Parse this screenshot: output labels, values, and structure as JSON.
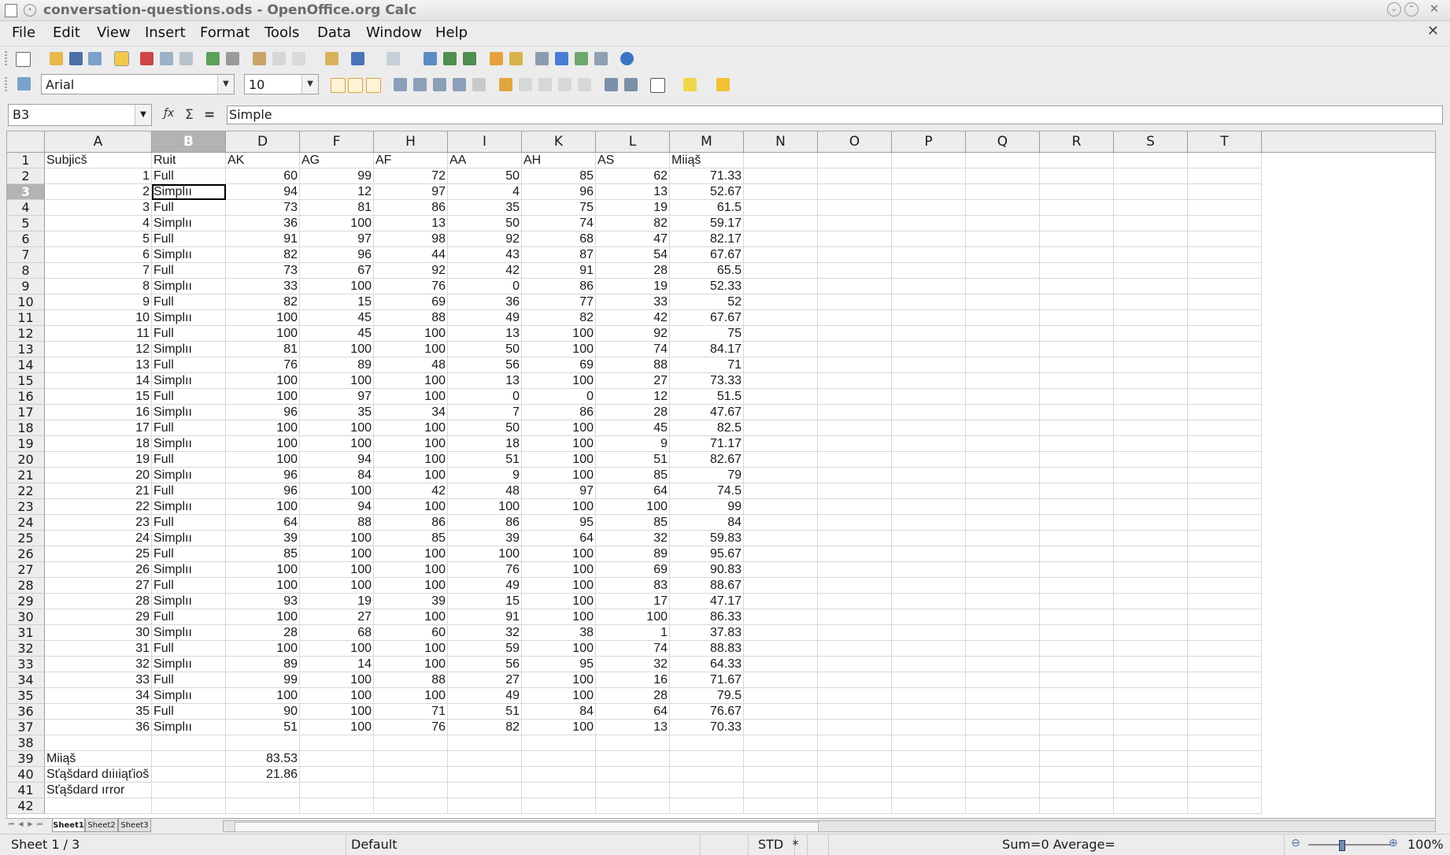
{
  "window": {
    "title": "conversation-questions.ods - OpenOffice.org Calc"
  },
  "menu": [
    "File",
    "Edit",
    "View",
    "Insert",
    "Format",
    "Tools",
    "Data",
    "Window",
    "Help"
  ],
  "toolbar": {
    "font_name": "Arial",
    "font_size": "10"
  },
  "formula_bar": {
    "cell_ref": "B3",
    "content": "Simple"
  },
  "columns": [
    "A",
    "B",
    "D",
    "F",
    "H",
    "I",
    "K",
    "L",
    "M",
    "N",
    "O",
    "P",
    "Q",
    "R",
    "S",
    "T"
  ],
  "selected_column": "B",
  "selected_row": 3,
  "header_row": [
    "Subjicš",
    "Ruit",
    "AK",
    "AG",
    "AF",
    "AA",
    "AH",
    "AS",
    "Miiąš"
  ],
  "data_rows": [
    [
      1,
      "Full",
      60,
      99,
      72,
      50,
      85,
      62,
      "71.33"
    ],
    [
      2,
      "Simplıı",
      94,
      12,
      97,
      4,
      96,
      13,
      "52.67"
    ],
    [
      3,
      "Full",
      73,
      81,
      86,
      35,
      75,
      19,
      "61.5"
    ],
    [
      4,
      "Simplıı",
      36,
      100,
      13,
      50,
      74,
      82,
      "59.17"
    ],
    [
      5,
      "Full",
      91,
      97,
      98,
      92,
      68,
      47,
      "82.17"
    ],
    [
      6,
      "Simplıı",
      82,
      96,
      44,
      43,
      87,
      54,
      "67.67"
    ],
    [
      7,
      "Full",
      73,
      67,
      92,
      42,
      91,
      28,
      "65.5"
    ],
    [
      8,
      "Simplıı",
      33,
      100,
      76,
      0,
      86,
      19,
      "52.33"
    ],
    [
      9,
      "Full",
      82,
      15,
      69,
      36,
      77,
      33,
      "52"
    ],
    [
      10,
      "Simplıı",
      100,
      45,
      88,
      49,
      82,
      42,
      "67.67"
    ],
    [
      11,
      "Full",
      100,
      45,
      100,
      13,
      100,
      92,
      "75"
    ],
    [
      12,
      "Simplıı",
      81,
      100,
      100,
      50,
      100,
      74,
      "84.17"
    ],
    [
      13,
      "Full",
      76,
      89,
      48,
      56,
      69,
      88,
      "71"
    ],
    [
      14,
      "Simplıı",
      100,
      100,
      100,
      13,
      100,
      27,
      "73.33"
    ],
    [
      15,
      "Full",
      100,
      97,
      100,
      0,
      0,
      12,
      "51.5"
    ],
    [
      16,
      "Simplıı",
      96,
      35,
      34,
      7,
      86,
      28,
      "47.67"
    ],
    [
      17,
      "Full",
      100,
      100,
      100,
      50,
      100,
      45,
      "82.5"
    ],
    [
      18,
      "Simplıı",
      100,
      100,
      100,
      18,
      100,
      9,
      "71.17"
    ],
    [
      19,
      "Full",
      100,
      94,
      100,
      51,
      100,
      51,
      "82.67"
    ],
    [
      20,
      "Simplıı",
      96,
      84,
      100,
      9,
      100,
      85,
      "79"
    ],
    [
      21,
      "Full",
      96,
      100,
      42,
      48,
      97,
      64,
      "74.5"
    ],
    [
      22,
      "Simplıı",
      100,
      94,
      100,
      100,
      100,
      100,
      "99"
    ],
    [
      23,
      "Full",
      64,
      88,
      86,
      86,
      95,
      85,
      "84"
    ],
    [
      24,
      "Simplıı",
      39,
      100,
      85,
      39,
      64,
      32,
      "59.83"
    ],
    [
      25,
      "Full",
      85,
      100,
      100,
      100,
      100,
      89,
      "95.67"
    ],
    [
      26,
      "Simplıı",
      100,
      100,
      100,
      76,
      100,
      69,
      "90.83"
    ],
    [
      27,
      "Full",
      100,
      100,
      100,
      49,
      100,
      83,
      "88.67"
    ],
    [
      28,
      "Simplıı",
      93,
      19,
      39,
      15,
      100,
      17,
      "47.17"
    ],
    [
      29,
      "Full",
      100,
      27,
      100,
      91,
      100,
      100,
      "86.33"
    ],
    [
      30,
      "Simplıı",
      28,
      68,
      60,
      32,
      38,
      1,
      "37.83"
    ],
    [
      31,
      "Full",
      100,
      100,
      100,
      59,
      100,
      74,
      "88.83"
    ],
    [
      32,
      "Simplıı",
      89,
      14,
      100,
      56,
      95,
      32,
      "64.33"
    ],
    [
      33,
      "Full",
      99,
      100,
      88,
      27,
      100,
      16,
      "71.67"
    ],
    [
      34,
      "Simplıı",
      100,
      100,
      100,
      49,
      100,
      28,
      "79.5"
    ],
    [
      35,
      "Full",
      90,
      100,
      71,
      51,
      84,
      64,
      "76.67"
    ],
    [
      36,
      "Simplıı",
      51,
      100,
      76,
      82,
      100,
      13,
      "70.33"
    ]
  ],
  "summary_rows": [
    {
      "label": "Miiąš",
      "value": "83.53"
    },
    {
      "label": "Sťąšdard dıiıiąťioš",
      "value": "21.86"
    },
    {
      "label": "Sťąšdard ırror",
      "value": ""
    }
  ],
  "sheet_tabs": [
    "Sheet1",
    "Sheet2",
    "Sheet3"
  ],
  "status": {
    "sheet": "Sheet 1 / 3",
    "style": "Default",
    "mode": "STD",
    "modified": "*",
    "sum": "Sum=0 Average=",
    "zoom": "100%"
  },
  "colors": {
    "selected_header": "#b3b3b3",
    "grid_line": "#d8d8d8"
  }
}
